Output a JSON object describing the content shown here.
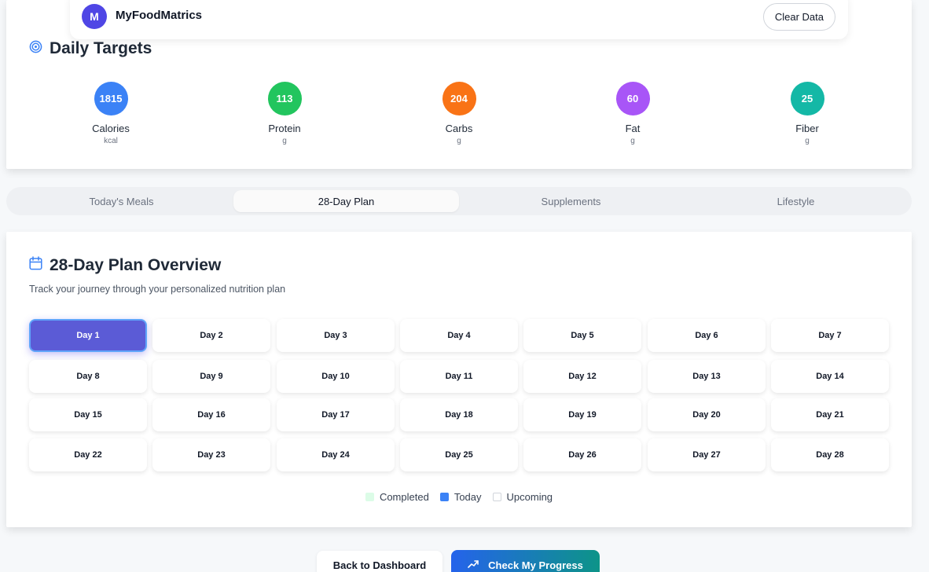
{
  "header": {
    "logo_letter": "M",
    "app_name": "MyFoodMatrics",
    "clear_button": "Clear Data"
  },
  "daily_targets": {
    "title": "Daily Targets",
    "items": [
      {
        "value": "1815",
        "name": "Calories",
        "unit": "kcal",
        "color": "#3b82f6"
      },
      {
        "value": "113",
        "name": "Protein",
        "unit": "g",
        "color": "#22c55e"
      },
      {
        "value": "204",
        "name": "Carbs",
        "unit": "g",
        "color": "#f97316"
      },
      {
        "value": "60",
        "name": "Fat",
        "unit": "g",
        "color": "#a855f7"
      },
      {
        "value": "25",
        "name": "Fiber",
        "unit": "g",
        "color": "#14b8a6"
      }
    ]
  },
  "tabs": [
    {
      "label": "Today's Meals",
      "active": false
    },
    {
      "label": "28-Day Plan",
      "active": true
    },
    {
      "label": "Supplements",
      "active": false
    },
    {
      "label": "Lifestyle",
      "active": false
    }
  ],
  "plan": {
    "title": "28-Day Plan Overview",
    "subtitle": "Track your journey through your personalized nutrition plan",
    "days": [
      "Day 1",
      "Day 2",
      "Day 3",
      "Day 4",
      "Day 5",
      "Day 6",
      "Day 7",
      "Day 8",
      "Day 9",
      "Day 10",
      "Day 11",
      "Day 12",
      "Day 13",
      "Day 14",
      "Day 15",
      "Day 16",
      "Day 17",
      "Day 18",
      "Day 19",
      "Day 20",
      "Day 21",
      "Day 22",
      "Day 23",
      "Day 24",
      "Day 25",
      "Day 26",
      "Day 27",
      "Day 28"
    ],
    "current_day": "Day 1",
    "legend": [
      {
        "label": "Completed",
        "color": "#dcfce7"
      },
      {
        "label": "Today",
        "color": "#3b82f6"
      },
      {
        "label": "Upcoming",
        "color": "#ffffff"
      }
    ]
  },
  "actions": {
    "back": "Back to Dashboard",
    "progress": "Check My Progress"
  }
}
